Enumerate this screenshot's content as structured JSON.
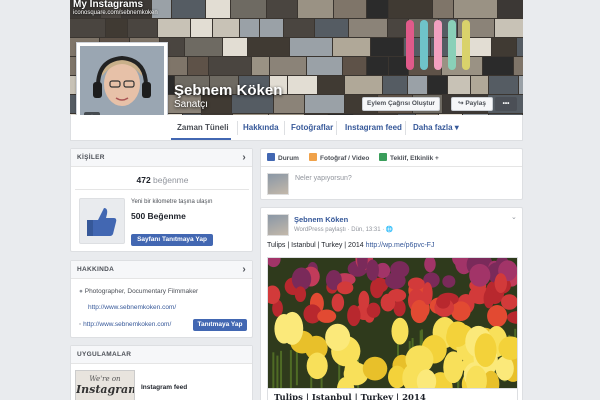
{
  "cover": {
    "title": "My Instagrams",
    "url": "iconosquare.com/sebnemkoken",
    "name": "Şebnem Köken",
    "role": "Sanatçı",
    "cta_label": "Eylem Çağrısı Oluştur",
    "share_label": "Paylaş",
    "more_label": "•••"
  },
  "nav": {
    "tabs": [
      "Zaman Tüneli",
      "Hakkında",
      "Fotoğraflar",
      "Instagram feed",
      "Daha fazla ▾"
    ]
  },
  "left": {
    "likes": {
      "header": "KİŞİLER",
      "count": "472",
      "count_label": "beğenme",
      "promo_text": "Yeni bir kilometre taşına ulaşın",
      "promo_count": "500 Beğenme",
      "promo_button": "Sayfanı Tanıtmaya Yap"
    },
    "about": {
      "header": "HAKKINDA",
      "line1": "Photographer, Documentary Filmmaker",
      "line2": "http://www.sebnemkoken.com/",
      "line3": "http://www.sebnemkoken.com/",
      "button": "Tanıtmaya Yap"
    },
    "apps": {
      "header": "UYGULAMALAR",
      "thumb_line1": "We're on",
      "thumb_line2": "Instagram",
      "item": "Instagram feed"
    }
  },
  "composer": {
    "status": "Durum",
    "photo": "Fotoğraf / Video",
    "offer": "Teklif, Etkinlik +",
    "placeholder": "Neler yapıyorsun?"
  },
  "post": {
    "author": "Şebnem Köken",
    "meta": "WordPress paylaştı · Dün, 13:31 · 🌐",
    "text": "Tulips | Istanbul | Turkey | 2014",
    "link": "http://wp.me/p6pvc-FJ",
    "caption": "Tulips | Istanbul | Turkey | 2014"
  },
  "colors": {
    "brand": "#4267b2",
    "link": "#365899",
    "background": "#e9ebee"
  }
}
